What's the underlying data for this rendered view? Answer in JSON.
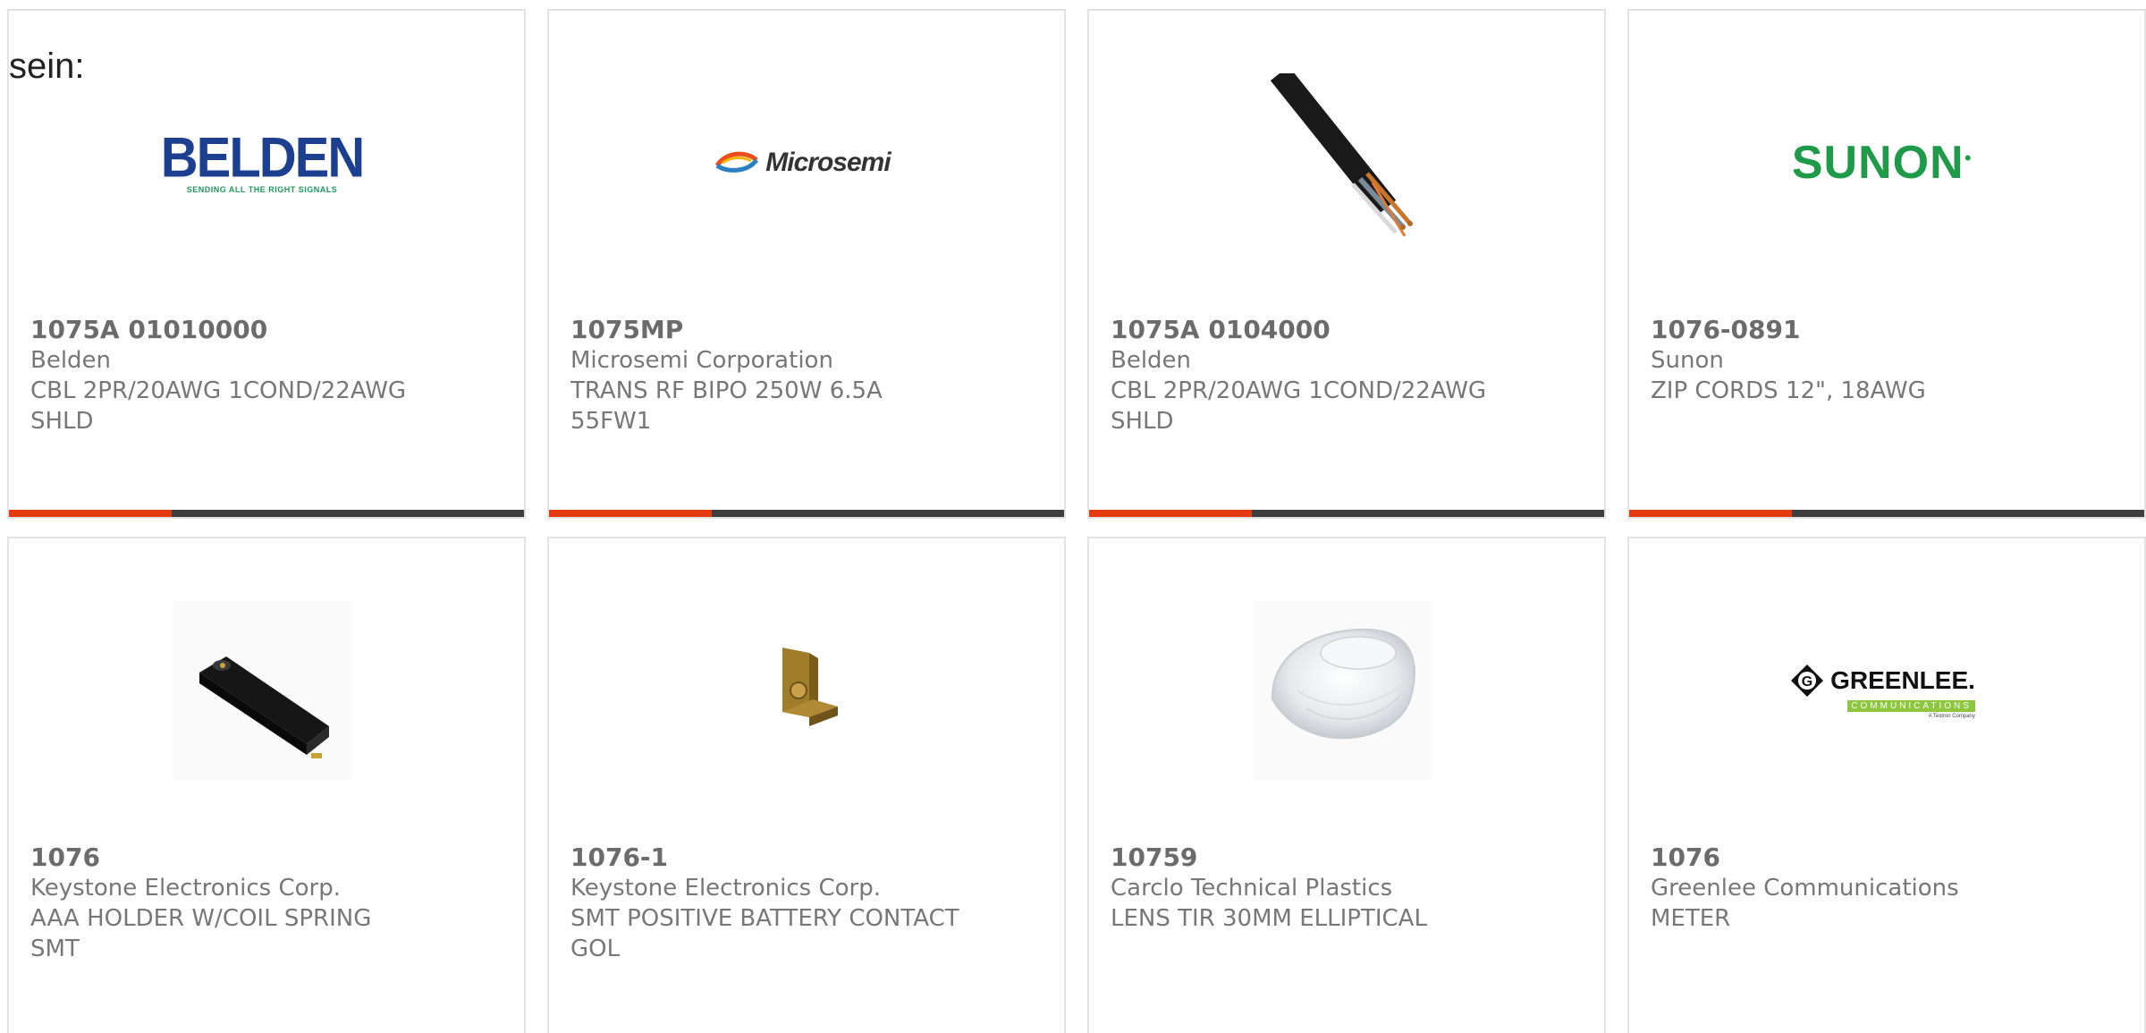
{
  "intro_text": "sein:",
  "colors": {
    "accent_red": "#e33a12",
    "bar_dark": "#3e3e3e",
    "card_border": "#e2e2e2",
    "text_gray": "#777777",
    "belden_blue": "#1d3f8f",
    "sunon_green": "#1e9a48",
    "greenlee_green": "#8dc63f"
  },
  "products": [
    {
      "part_number": "1075A 01010000",
      "manufacturer": "Belden",
      "description": "CBL 2PR/20AWG 1COND/22AWG SHLD",
      "image": "belden-logo",
      "logo": {
        "word": "BELDEN",
        "tagline": "SENDING ALL THE RIGHT SIGNALS"
      }
    },
    {
      "part_number": "1075MP",
      "manufacturer": "Microsemi Corporation",
      "description": "TRANS RF BIPO 250W 6.5A 55FW1",
      "image": "microsemi-logo",
      "logo": {
        "word": "Microsemi"
      }
    },
    {
      "part_number": "1075A 0104000",
      "manufacturer": "Belden",
      "description": "CBL 2PR/20AWG 1COND/22AWG SHLD",
      "image": "cable-photo"
    },
    {
      "part_number": "1076-0891",
      "manufacturer": "Sunon",
      "description": "ZIP CORDS 12\", 18AWG",
      "image": "sunon-logo",
      "logo": {
        "word": "SUNON"
      }
    },
    {
      "part_number": "1076",
      "manufacturer": "Keystone Electronics Corp.",
      "description": "AAA HOLDER W/COIL SPRING SMT",
      "image": "battery-holder-photo"
    },
    {
      "part_number": "1076-1",
      "manufacturer": "Keystone Electronics Corp.",
      "description": "SMT POSITIVE BATTERY CONTACT GOL",
      "image": "battery-contact-photo"
    },
    {
      "part_number": "10759",
      "manufacturer": "Carclo Technical Plastics",
      "description": "LENS TIR 30MM ELLIPTICAL",
      "image": "lens-photo"
    },
    {
      "part_number": "1076",
      "manufacturer": "Greenlee Communications",
      "description": "METER",
      "image": "greenlee-logo",
      "logo": {
        "word": "GREENLEE.",
        "sub": "COMMUNICATIONS",
        "tagline": "A Textron Company"
      }
    }
  ]
}
